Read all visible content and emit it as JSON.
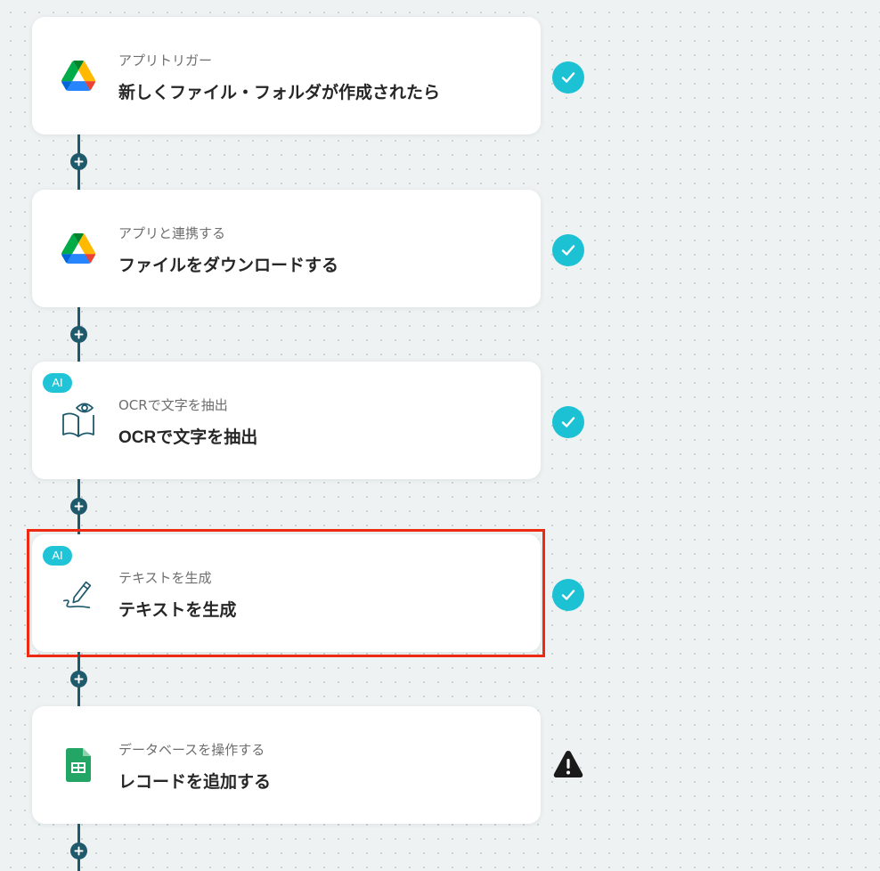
{
  "steps": [
    {
      "sub": "アプリトリガー",
      "title": "新しくファイル・フォルダが作成されたら",
      "icon": "google-drive-icon",
      "ai": false,
      "status": "complete",
      "highlighted": false
    },
    {
      "sub": "アプリと連携する",
      "title": "ファイルをダウンロードする",
      "icon": "google-drive-icon",
      "ai": false,
      "status": "complete",
      "highlighted": false
    },
    {
      "sub": "OCRで文字を抽出",
      "title": "OCRで文字を抽出",
      "icon": "ocr-book-eye-icon",
      "ai": true,
      "ai_label": "AI",
      "status": "complete",
      "highlighted": false
    },
    {
      "sub": "テキストを生成",
      "title": "テキストを生成",
      "icon": "pen-scribble-icon",
      "ai": true,
      "ai_label": "AI",
      "status": "complete",
      "highlighted": true
    },
    {
      "sub": "データベースを操作する",
      "title": "レコードを追加する",
      "icon": "google-sheets-icon",
      "ai": false,
      "status": "warning",
      "highlighted": false
    }
  ],
  "colors": {
    "accent": "#1cc2d4",
    "connector": "#1f5a6c",
    "highlight_border": "#ee2a12",
    "warning": "#1a1a1a"
  }
}
